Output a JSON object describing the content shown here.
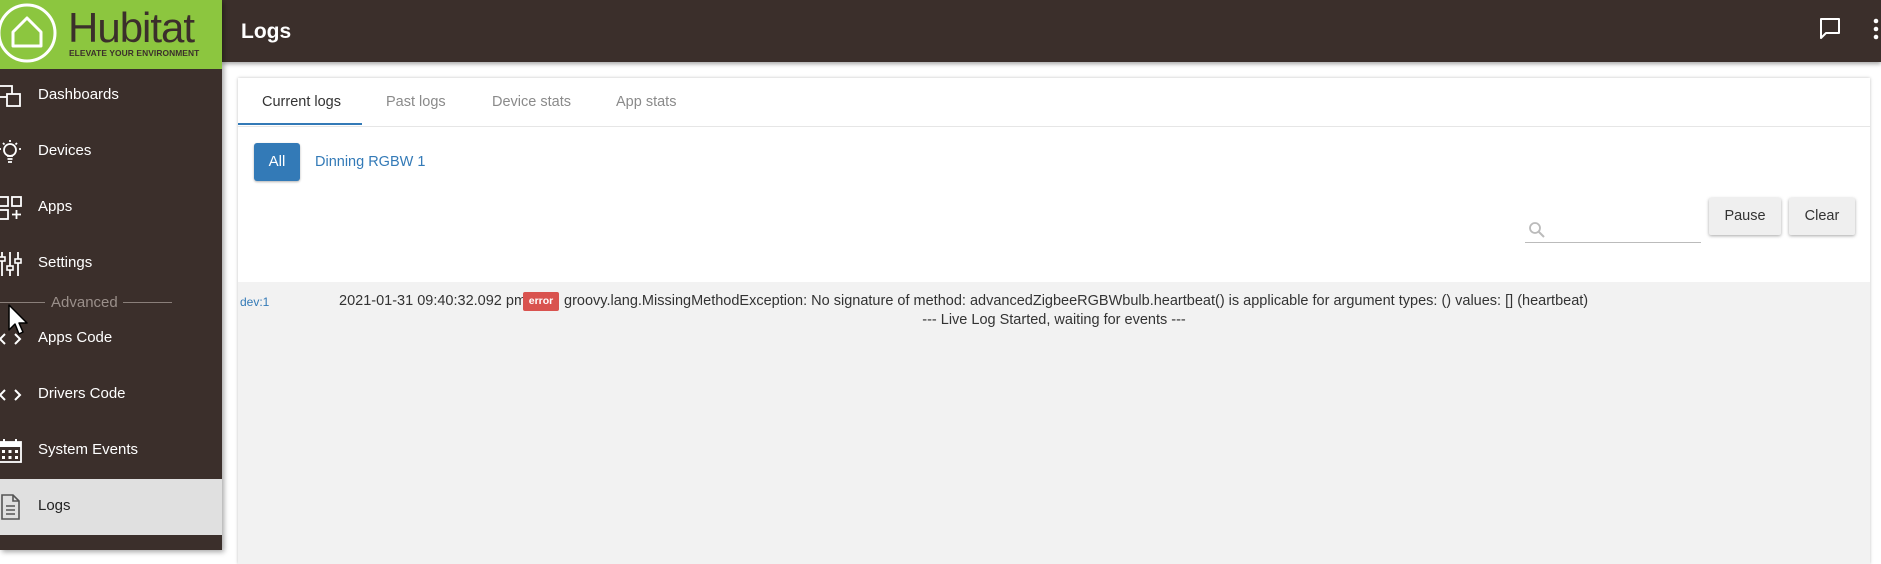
{
  "header": {
    "title": "Logs"
  },
  "logo": {
    "brand": "Hubitat",
    "tagline": "ELEVATE YOUR ENVIRONMENT"
  },
  "sidebar": {
    "items": [
      {
        "label": "Dashboards",
        "icon": "dashboards-icon"
      },
      {
        "label": "Devices",
        "icon": "lightbulb-icon"
      },
      {
        "label": "Apps",
        "icon": "apps-icon"
      },
      {
        "label": "Settings",
        "icon": "sliders-icon"
      },
      {
        "label": "Apps Code",
        "icon": "code-icon"
      },
      {
        "label": "Drivers Code",
        "icon": "code-icon"
      },
      {
        "label": "System Events",
        "icon": "calendar-icon"
      },
      {
        "label": "Logs",
        "icon": "document-icon",
        "active": true
      }
    ],
    "section_label": "Advanced"
  },
  "tabs": [
    {
      "label": "Current logs",
      "active": true
    },
    {
      "label": "Past logs"
    },
    {
      "label": "Device stats"
    },
    {
      "label": "App stats"
    }
  ],
  "filters": {
    "all_label": "All",
    "device_label": "Dinning RGBW 1"
  },
  "search": {
    "placeholder": "",
    "value": ""
  },
  "actions": {
    "pause_label": "Pause",
    "clear_label": "Clear"
  },
  "log": {
    "source": "dev:1",
    "timestamp": "2021-01-31 09:40:32.092 pm",
    "level": "error",
    "message": "groovy.lang.MissingMethodException: No signature of method: advancedZigbeeRGBWbulb.heartbeat() is applicable for argument types: () values: [] (heartbeat)",
    "status": "--- Live Log Started, waiting for events ---"
  },
  "colors": {
    "header_bg": "#3b2f2b",
    "logo_bg": "#8cc63f",
    "accent": "#337ab7",
    "error": "#d9534f",
    "log_bg": "#f2f2f2"
  }
}
